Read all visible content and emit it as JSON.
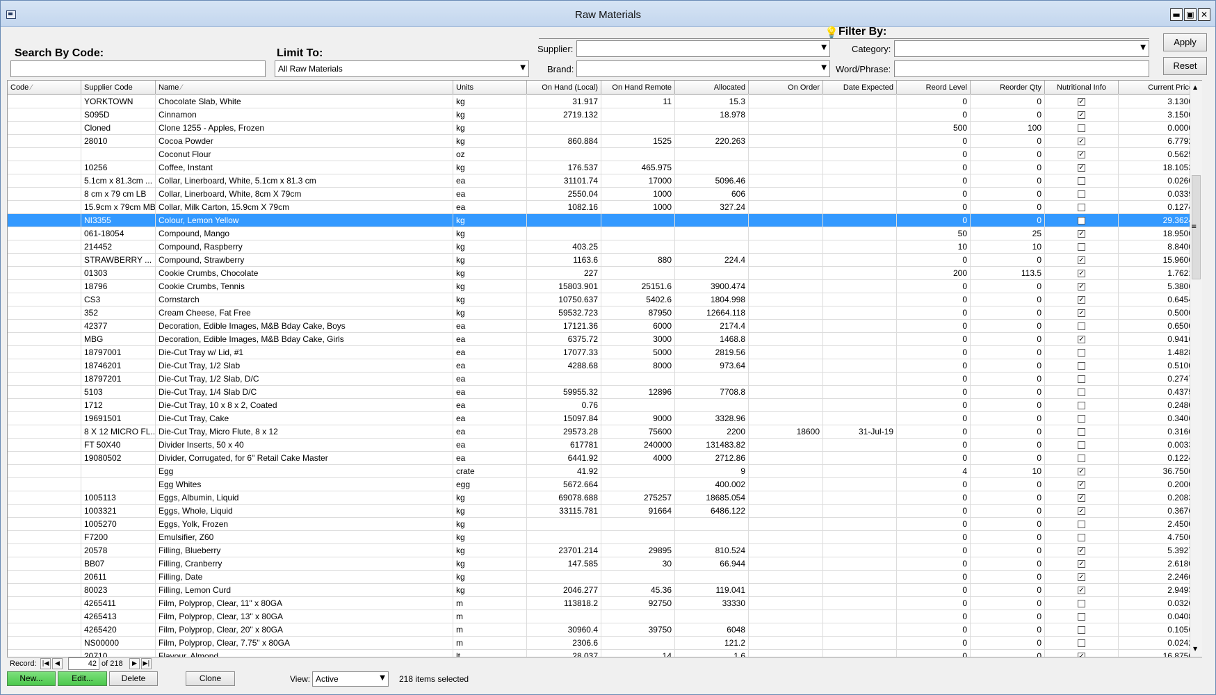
{
  "window": {
    "title": "Raw Materials"
  },
  "icons": {
    "app": "app-window-icon",
    "filter": "lightbulb-icon",
    "dropdown": "chevron-down-icon",
    "sort": "sort-icon"
  },
  "colors": {
    "selection": "#3399ff",
    "new_edit": "#5cd65c",
    "titlebar": "#c9daf0"
  },
  "search": {
    "label": "Search By Code:",
    "value": ""
  },
  "limit": {
    "label": "Limit To:",
    "value": "All Raw Materials"
  },
  "filter": {
    "title": "Filter By:",
    "supplier_label": "Supplier:",
    "supplier_value": "",
    "category_label": "Category:",
    "category_value": "",
    "brand_label": "Brand:",
    "brand_value": "",
    "word_label": "Word/Phrase:",
    "word_value": "",
    "apply_label": "Apply",
    "reset_label": "Reset"
  },
  "columns": [
    "Code",
    "Supplier Code",
    "Name",
    "Units",
    "On Hand (Local)",
    "On Hand Remote",
    "Allocated",
    "On Order",
    "Date Expected",
    "Reord Level",
    "Reorder Qty",
    "Nutritional Info",
    "Current Price"
  ],
  "rows": [
    [
      "",
      "YORKTOWN",
      "Chocolate Slab, White",
      "kg",
      "31.917",
      "11",
      "15.3",
      "",
      "",
      "0",
      "0",
      true,
      "3.1300"
    ],
    [
      "",
      "S095D",
      "Cinnamon",
      "kg",
      "2719.132",
      "",
      "18.978",
      "",
      "",
      "0",
      "0",
      true,
      "3.1500"
    ],
    [
      "",
      "Cloned",
      "Clone 1255 - Apples, Frozen",
      "kg",
      "",
      "",
      "",
      "",
      "",
      "500",
      "100",
      false,
      "0.0000"
    ],
    [
      "",
      "28010",
      "Cocoa Powder",
      "kg",
      "860.884",
      "1525",
      "220.263",
      "",
      "",
      "0",
      "0",
      true,
      "6.7792"
    ],
    [
      "",
      "",
      "Coconut Flour",
      "oz",
      "",
      "",
      "",
      "",
      "",
      "0",
      "0",
      true,
      "0.5625"
    ],
    [
      "",
      "10256",
      "Coffee, Instant",
      "kg",
      "176.537",
      "465.975",
      "",
      "",
      "",
      "0",
      "0",
      true,
      "18.1053"
    ],
    [
      "",
      "5.1cm x 81.3cm ...",
      "Collar, Linerboard, White, 5.1cm x 81.3 cm",
      "ea",
      "31101.74",
      "17000",
      "5096.46",
      "",
      "",
      "0",
      "0",
      false,
      "0.0260"
    ],
    [
      "",
      "8 cm x 79 cm LB",
      "Collar, Linerboard, White, 8cm X 79cm",
      "ea",
      "2550.04",
      "1000",
      "606",
      "",
      "",
      "0",
      "0",
      false,
      "0.0339"
    ],
    [
      "",
      "15.9cm x 79cm MB",
      "Collar, Milk Carton, 15.9cm X 79cm",
      "ea",
      "1082.16",
      "1000",
      "327.24",
      "",
      "",
      "0",
      "0",
      false,
      "0.1274"
    ],
    [
      "",
      "NI3355",
      "Colour,  Lemon Yellow",
      "kg",
      "",
      "",
      "",
      "",
      "",
      "0",
      "0",
      false,
      "29.3624"
    ],
    [
      "",
      "061-18054",
      "Compound, Mango",
      "kg",
      "",
      "",
      "",
      "",
      "",
      "50",
      "25",
      true,
      "18.9500"
    ],
    [
      "",
      "214452",
      "Compound, Raspberry",
      "kg",
      "403.25",
      "",
      "",
      "",
      "",
      "10",
      "10",
      false,
      "8.8400"
    ],
    [
      "",
      "STRAWBERRY ...",
      "Compound, Strawberry",
      "kg",
      "1163.6",
      "880",
      "224.4",
      "",
      "",
      "0",
      "0",
      true,
      "15.9600"
    ],
    [
      "",
      "01303",
      "Cookie Crumbs, Chocolate",
      "kg",
      "227",
      "",
      "",
      "",
      "",
      "200",
      "113.5",
      true,
      "1.7621"
    ],
    [
      "",
      "18796",
      "Cookie Crumbs, Tennis",
      "kg",
      "15803.901",
      "25151.6",
      "3900.474",
      "",
      "",
      "0",
      "0",
      true,
      "5.3806"
    ],
    [
      "",
      "CS3",
      "Cornstarch",
      "kg",
      "10750.637",
      "5402.6",
      "1804.998",
      "",
      "",
      "0",
      "0",
      true,
      "0.6454"
    ],
    [
      "",
      "352",
      "Cream Cheese, Fat Free",
      "kg",
      "59532.723",
      "87950",
      "12664.118",
      "",
      "",
      "0",
      "0",
      true,
      "0.5000"
    ],
    [
      "",
      "42377",
      "Decoration, Edible Images, M&B Bday Cake, Boys",
      "ea",
      "17121.36",
      "6000",
      "2174.4",
      "",
      "",
      "0",
      "0",
      false,
      "0.6500"
    ],
    [
      "",
      "MBG",
      "Decoration, Edible Images, M&B Bday Cake, Girls",
      "ea",
      "6375.72",
      "3000",
      "1468.8",
      "",
      "",
      "0",
      "0",
      true,
      "0.9416"
    ],
    [
      "",
      "18797001",
      "Die-Cut Tray w/ Lid, #1",
      "ea",
      "17077.33",
      "5000",
      "2819.56",
      "",
      "",
      "0",
      "0",
      false,
      "1.4828"
    ],
    [
      "",
      "18746201",
      "Die-Cut Tray, 1/2 Slab",
      "ea",
      "4288.68",
      "8000",
      "973.64",
      "",
      "",
      "0",
      "0",
      false,
      "0.5100"
    ],
    [
      "",
      "18797201",
      "Die-Cut Tray, 1/2 Slab, D/C",
      "ea",
      "",
      "",
      "",
      "",
      "",
      "0",
      "0",
      false,
      "0.2747"
    ],
    [
      "",
      "5103",
      "Die-Cut Tray, 1/4 Slab D/C",
      "ea",
      "59955.32",
      "12896",
      "7708.8",
      "",
      "",
      "0",
      "0",
      false,
      "0.4375"
    ],
    [
      "",
      "1712",
      "Die-Cut Tray, 10 x 8 x 2, Coated",
      "ea",
      "0.76",
      "",
      "",
      "",
      "",
      "0",
      "0",
      false,
      "0.2480"
    ],
    [
      "",
      "19691501",
      "Die-Cut Tray, Cake",
      "ea",
      "15097.84",
      "9000",
      "3328.96",
      "",
      "",
      "0",
      "0",
      false,
      "0.3406"
    ],
    [
      "",
      "8 X 12 MICRO FL...",
      "Die-Cut Tray, Micro Flute, 8 x 12",
      "ea",
      "29573.28",
      "75600",
      "2200",
      "18600",
      "31-Jul-19",
      "0",
      "0",
      false,
      "0.3160"
    ],
    [
      "",
      "FT 50X40",
      "Divider Inserts, 50 x 40",
      "ea",
      "617781",
      "240000",
      "131483.82",
      "",
      "",
      "0",
      "0",
      false,
      "0.0033"
    ],
    [
      "",
      "19080502",
      "Divider, Corrugated, for 6\" Retail Cake Master",
      "ea",
      "6441.92",
      "4000",
      "2712.86",
      "",
      "",
      "0",
      "0",
      false,
      "0.1224"
    ],
    [
      "",
      "",
      "Egg",
      "crate",
      "41.92",
      "",
      "9",
      "",
      "",
      "4",
      "10",
      true,
      "36.7500"
    ],
    [
      "",
      "",
      "Egg Whites",
      "egg",
      "5672.664",
      "",
      "400.002",
      "",
      "",
      "0",
      "0",
      true,
      "0.2000"
    ],
    [
      "",
      "1005113",
      "Eggs, Albumin, Liquid",
      "kg",
      "69078.688",
      "275257",
      "18685.054",
      "",
      "",
      "0",
      "0",
      true,
      "0.2083"
    ],
    [
      "",
      "1003321",
      "Eggs, Whole, Liquid",
      "kg",
      "33115.781",
      "91664",
      "6486.122",
      "",
      "",
      "0",
      "0",
      true,
      "0.3676"
    ],
    [
      "",
      "1005270",
      "Eggs, Yolk, Frozen",
      "kg",
      "",
      "",
      "",
      "",
      "",
      "0",
      "0",
      false,
      "2.4500"
    ],
    [
      "",
      "F7200",
      "Emulsifier, Z60",
      "kg",
      "",
      "",
      "",
      "",
      "",
      "0",
      "0",
      false,
      "4.7500"
    ],
    [
      "",
      "20578",
      "Filling, Blueberry",
      "kg",
      "23701.214",
      "29895",
      "810.524",
      "",
      "",
      "0",
      "0",
      true,
      "5.3927"
    ],
    [
      "",
      "BB07",
      "Filling, Cranberry",
      "kg",
      "147.585",
      "30",
      "66.944",
      "",
      "",
      "0",
      "0",
      true,
      "2.6180"
    ],
    [
      "",
      "20611",
      "Filling, Date",
      "kg",
      "",
      "",
      "",
      "",
      "",
      "0",
      "0",
      true,
      "2.2460"
    ],
    [
      "",
      "80023",
      "Filling, Lemon Curd",
      "kg",
      "2046.277",
      "45.36",
      "119.041",
      "",
      "",
      "0",
      "0",
      true,
      "2.9493"
    ],
    [
      "",
      "4265411",
      "Film, Polyprop, Clear, 11\" x 80GA",
      "m",
      "113818.2",
      "92750",
      "33330",
      "",
      "",
      "0",
      "0",
      false,
      "0.0326"
    ],
    [
      "",
      "4265413",
      "Film, Polyprop, Clear, 13\" x 80GA",
      "m",
      "",
      "",
      "",
      "",
      "",
      "0",
      "0",
      false,
      "0.0408"
    ],
    [
      "",
      "4265420",
      "Film, Polyprop, Clear, 20\" x 80GA",
      "m",
      "30960.4",
      "39750",
      "6048",
      "",
      "",
      "0",
      "0",
      false,
      "0.1056"
    ],
    [
      "",
      "NS00000",
      "Film, Polyprop, Clear, 7.75\" x 80GA",
      "m",
      "2306.6",
      "",
      "121.2",
      "",
      "",
      "0",
      "0",
      false,
      "0.0242"
    ],
    [
      "",
      "20710",
      "Flavour, Almond",
      "lt",
      "28.037",
      "14",
      "1.6",
      "",
      "",
      "0",
      "0",
      true,
      "16.8750"
    ]
  ],
  "selected_row": 9,
  "record": {
    "label": "Record:",
    "current": "42",
    "of_text": "of 218"
  },
  "buttons": {
    "new": "New...",
    "edit": "Edit...",
    "delete": "Delete",
    "clone": "Clone"
  },
  "view": {
    "label": "View:",
    "value": "Active"
  },
  "status": "218 items selected"
}
